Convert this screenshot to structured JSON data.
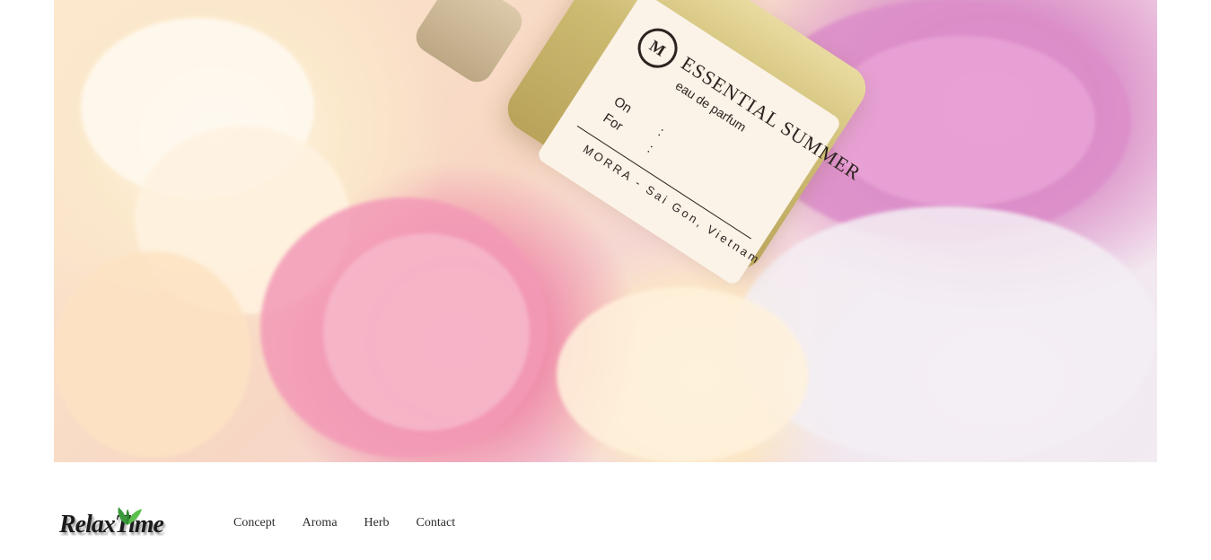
{
  "hero": {
    "bottle_label": {
      "brand_mark": "M",
      "title": "ESSENTIAL SUMMER",
      "subtitle": "eau de parfum",
      "on_label": "On",
      "for_label": "For",
      "colons": ":\n:",
      "maker": "MORRA - Sai Gon, Vietnam"
    }
  },
  "logo": {
    "text": "RelaxTime"
  },
  "nav": {
    "items": [
      {
        "label": "Concept"
      },
      {
        "label": "Aroma"
      },
      {
        "label": "Herb"
      },
      {
        "label": "Contact"
      }
    ]
  }
}
